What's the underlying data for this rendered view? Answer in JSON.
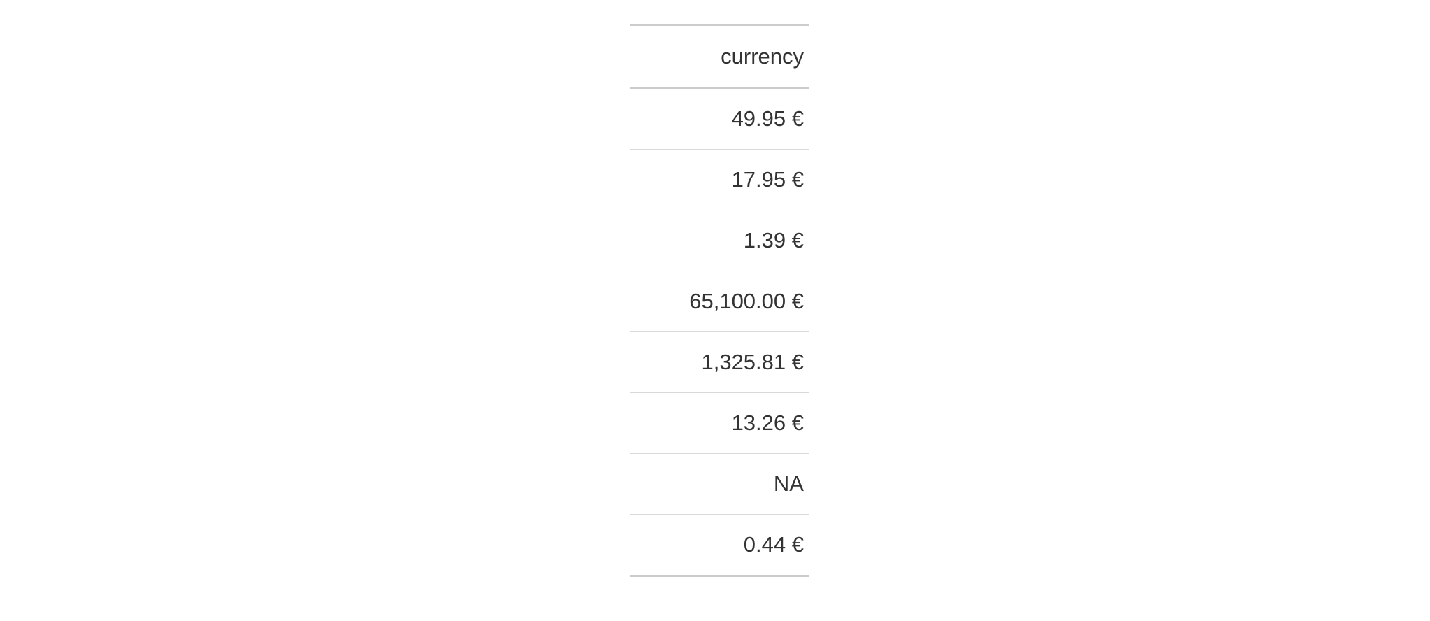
{
  "page": {
    "background_color": "#ffffff",
    "text_color": "#333333",
    "rule_color_strong": "#cccccc",
    "rule_color_light": "#d9d9d9"
  },
  "table": {
    "column_header": "currency",
    "alignment": "right",
    "rows": [
      {
        "value": "49.95 €"
      },
      {
        "value": "17.95 €"
      },
      {
        "value": "1.39 €"
      },
      {
        "value": "65,100.00 €"
      },
      {
        "value": "1,325.81 €"
      },
      {
        "value": "13.26 €"
      },
      {
        "value": "NA"
      },
      {
        "value": "0.44 €"
      }
    ]
  },
  "chart_data": {
    "type": "table",
    "title": "",
    "columns": [
      "currency"
    ],
    "values": [
      "49.95 €",
      "17.95 €",
      "1.39 €",
      "65,100.00 €",
      "1,325.81 €",
      "13.26 €",
      "NA",
      "0.44 €"
    ],
    "numeric_values": [
      49.95,
      17.95,
      1.39,
      65100.0,
      1325.81,
      13.26,
      null,
      0.44
    ],
    "currency_symbol": "€",
    "missing_label": "NA",
    "decimal_separator": ".",
    "thousands_separator": ","
  }
}
